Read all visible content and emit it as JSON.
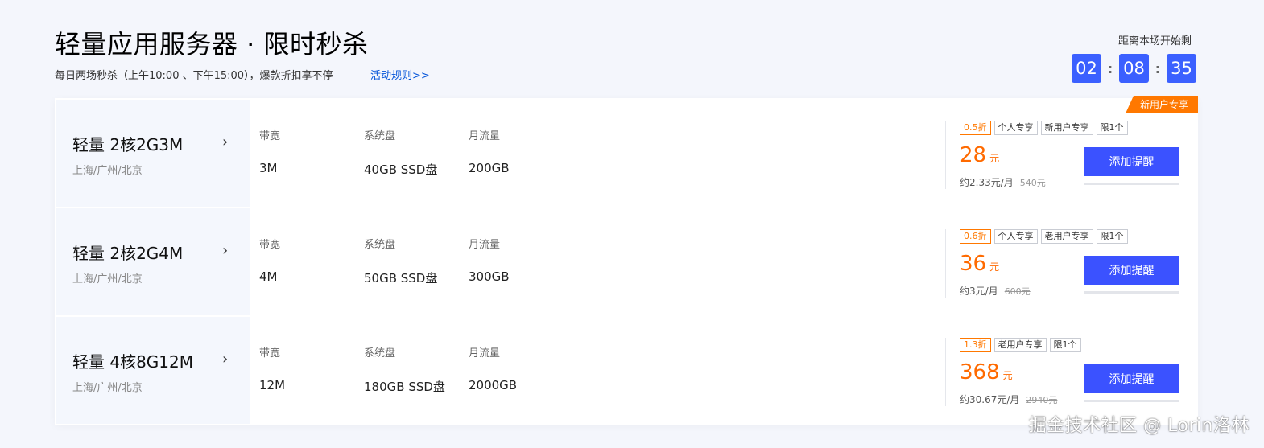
{
  "header": {
    "title": "轻量应用服务器 · 限时秒杀",
    "subtitle": "每日两场秒杀（上午10:00 、下午15:00），爆款折扣享不停",
    "rules_link": "活动规则>>"
  },
  "countdown": {
    "label": "距离本场开始剩",
    "hours": "02",
    "minutes": "08",
    "seconds": "35",
    "sep": ":"
  },
  "ribbon": "新用户专享",
  "spec_labels": {
    "bandwidth": "带宽",
    "disk": "系统盘",
    "traffic": "月流量"
  },
  "products": [
    {
      "name": "轻量 2核2G3M",
      "region": "上海/广州/北京",
      "bandwidth": "3M",
      "disk": "40GB SSD盘",
      "traffic": "200GB",
      "tags": [
        "0.5折",
        "个人专享",
        "新用户专享",
        "限1个"
      ],
      "price": "28",
      "price_unit": "元",
      "monthly": "约2.33元/月",
      "original": "540元",
      "button": "添加提醒"
    },
    {
      "name": "轻量 2核2G4M",
      "region": "上海/广州/北京",
      "bandwidth": "4M",
      "disk": "50GB SSD盘",
      "traffic": "300GB",
      "tags": [
        "0.6折",
        "个人专享",
        "老用户专享",
        "限1个"
      ],
      "price": "36",
      "price_unit": "元",
      "monthly": "约3元/月",
      "original": "600元",
      "button": "添加提醒"
    },
    {
      "name": "轻量 4核8G12M",
      "region": "上海/广州/北京",
      "bandwidth": "12M",
      "disk": "180GB SSD盘",
      "traffic": "2000GB",
      "tags": [
        "1.3折",
        "老用户专享",
        "限1个"
      ],
      "price": "368",
      "price_unit": "元",
      "monthly": "约30.67元/月",
      "original": "2940元",
      "button": "添加提醒"
    }
  ],
  "watermark": "掘金技术社区 @ Lorin洛林",
  "colors": {
    "accent": "#3b52ff",
    "price": "#ff6a00",
    "ribbon": "#ff7800",
    "link": "#0052d9"
  }
}
